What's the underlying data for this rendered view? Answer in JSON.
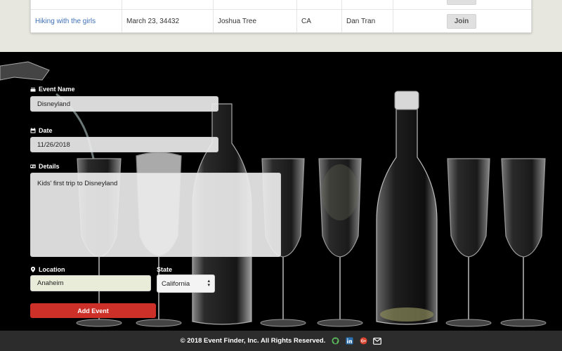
{
  "table": {
    "row": {
      "event": "Hiking with the girls",
      "date": "March 23, 34432",
      "city": "Joshua Tree",
      "state": "CA",
      "host": "Dan Tran",
      "action_label": "Join"
    }
  },
  "form": {
    "event_name": {
      "label": "Event Name",
      "value": "Disneyland"
    },
    "date": {
      "label": "Date",
      "value": "11/26/2018"
    },
    "details": {
      "label": "Details",
      "value": "Kids' first trip to Disneyland"
    },
    "location": {
      "label": "Location",
      "value": "Anaheim"
    },
    "state": {
      "label": "State",
      "value": "California"
    },
    "submit_label": "Add Event"
  },
  "footer": {
    "copyright": "© 2018 Event Finder, Inc. All Rights Reserved.",
    "icons": [
      "github-icon",
      "linkedin-icon",
      "google-plus-icon",
      "mail-icon"
    ]
  },
  "colors": {
    "accent_red": "#cd3028",
    "link_blue": "#3f6fb5",
    "footer_bg": "#2c2c2c",
    "page_bg": "#e7e7e0"
  }
}
